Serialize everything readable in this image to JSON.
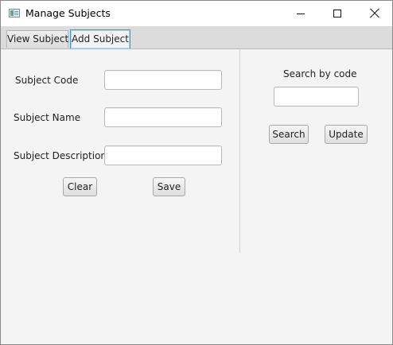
{
  "window": {
    "title": "Manage Subjects",
    "icon": "java-app-icon"
  },
  "tabs": [
    {
      "label": "View Subject",
      "selected": false
    },
    {
      "label": "Add Subject",
      "selected": true
    }
  ],
  "form": {
    "code_label": "Subject Code",
    "code_value": "",
    "name_label": "Subject Name",
    "name_value": "",
    "description_label": "Subject Description",
    "description_value": "",
    "clear_label": "Clear",
    "save_label": "Save"
  },
  "search": {
    "label": "Search by code",
    "value": "",
    "search_label": "Search",
    "update_label": "Update"
  },
  "colors": {
    "selected_tab_border": "#3d9ad9",
    "background": "#f4f4f4"
  }
}
